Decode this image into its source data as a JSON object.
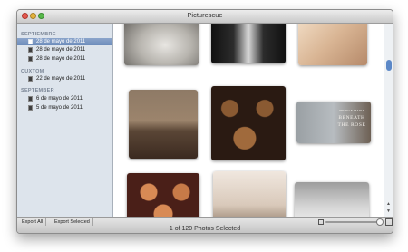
{
  "window": {
    "title": "Picturescue"
  },
  "sidebar": {
    "sections": [
      {
        "heading": "SEPTIEMBRE",
        "items": [
          {
            "label": "28 de mayo de 2011",
            "selected": true
          },
          {
            "label": "28 de mayo de 2011",
            "selected": false
          },
          {
            "label": "28 de mayo de 2011",
            "selected": false
          }
        ]
      },
      {
        "heading": "CUXTOM",
        "items": [
          {
            "label": "22 de mayo de 2011",
            "selected": false
          }
        ]
      },
      {
        "heading": "SEPTEMBER",
        "items": [
          {
            "label": "6 de mayo de 2011",
            "selected": false
          },
          {
            "label": "5 de mayo de 2011",
            "selected": false
          }
        ]
      }
    ]
  },
  "grid": {
    "photos": [
      {
        "name": "bride-dress",
        "overlay": []
      },
      {
        "name": "church-aisle",
        "overlay": []
      },
      {
        "name": "sepia-fabric",
        "overlay": []
      },
      {
        "name": "olive-grove",
        "overlay": []
      },
      {
        "name": "cupcakes",
        "overlay": []
      },
      {
        "name": "beneath-the-rose",
        "overlay": [
          "PEDRO & MARIA",
          "BENEATH",
          "THE ROSE"
        ]
      },
      {
        "name": "cupcakes-bottom",
        "overlay": []
      },
      {
        "name": "dancer",
        "overlay": []
      },
      {
        "name": "beach-couple",
        "overlay": []
      }
    ]
  },
  "bottombar": {
    "export_all": "Export All",
    "export_selected": "Export Selected",
    "status": "1 of 120 Photos Selected"
  },
  "icons": {
    "item": "photo-album-icon",
    "zoom_small": "small-thumbnail-icon",
    "zoom_large": "large-thumbnail-icon"
  },
  "colors": {
    "sidebar_bg": "#dde4ec",
    "selection": "#7896c4",
    "section_heading": "#7b8696",
    "scroll_thumb": "#5c88c7"
  }
}
